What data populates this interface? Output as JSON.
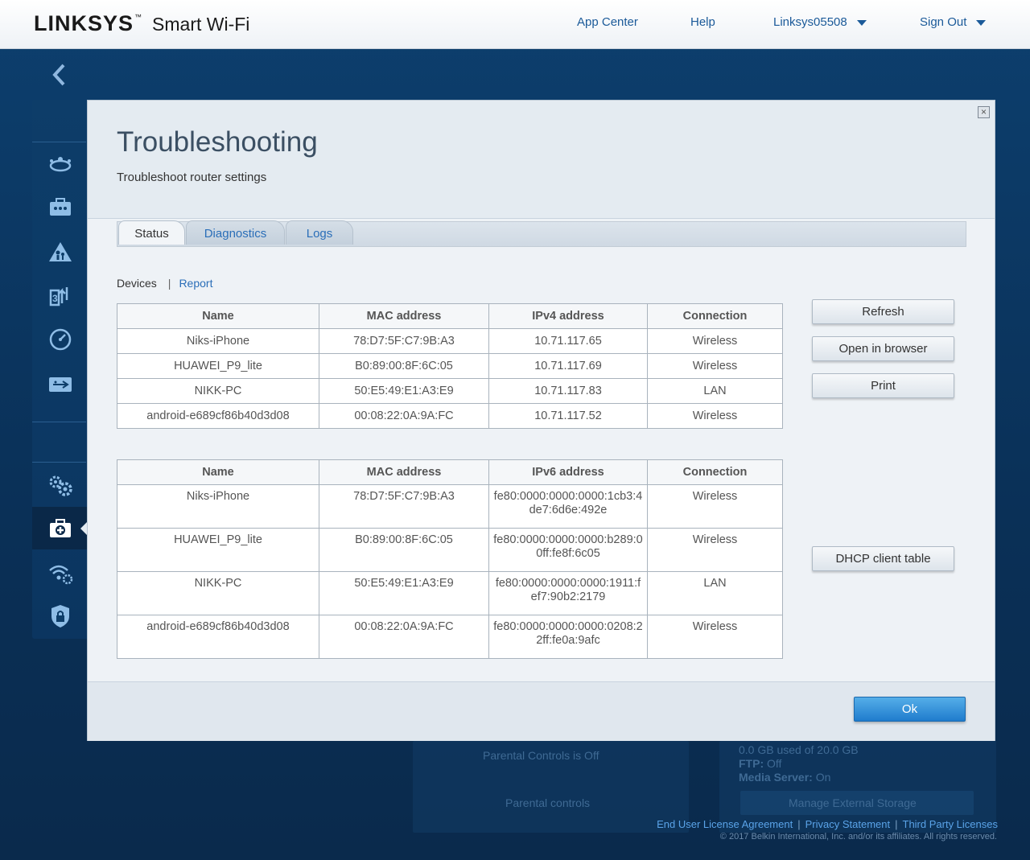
{
  "header": {
    "brand": "LINKSYS",
    "brand_tm": "™",
    "brand_sub": "Smart Wi-Fi",
    "nav": {
      "app_center": "App Center",
      "help": "Help",
      "account": "Linksys05508",
      "sign_out": "Sign Out"
    }
  },
  "sidebar": {
    "icons": [
      "network-map-icon",
      "devices-icon",
      "parental-controls-icon",
      "media-prioritization-icon",
      "speed-test-icon",
      "usb-storage-icon",
      "connectivity-icon",
      "troubleshooting-icon",
      "wireless-icon",
      "security-icon"
    ],
    "active": "troubleshooting-icon"
  },
  "background": {
    "text_1": "Parental Controls is Off",
    "text_2": "Parental controls",
    "text_3": "0.0 GB used of 20.0 GB",
    "ftp_label": "FTP:",
    "ftp_value": "Off",
    "media_label": "Media Server:",
    "media_value": "On",
    "manage_button": "Manage External Storage"
  },
  "modal": {
    "title": "Troubleshooting",
    "subtitle": "Troubleshoot router settings",
    "close_glyph": "×",
    "tabs": [
      "Status",
      "Diagnostics",
      "Logs"
    ],
    "active_tab": "Status",
    "subnav": {
      "devices": "Devices",
      "report": "Report"
    },
    "ipv4_table": {
      "headers": [
        "Name",
        "MAC address",
        "IPv4 address",
        "Connection"
      ],
      "rows": [
        [
          "Niks-iPhone",
          "78:D7:5F:C7:9B:A3",
          "10.71.117.65",
          "Wireless"
        ],
        [
          "HUAWEI_P9_lite",
          "B0:89:00:8F:6C:05",
          "10.71.117.69",
          "Wireless"
        ],
        [
          "NIKK-PC",
          "50:E5:49:E1:A3:E9",
          "10.71.117.83",
          "LAN"
        ],
        [
          "android-e689cf86b40d3d08",
          "00:08:22:0A:9A:FC",
          "10.71.117.52",
          "Wireless"
        ]
      ]
    },
    "ipv6_table": {
      "headers": [
        "Name",
        "MAC address",
        "IPv6 address",
        "Connection"
      ],
      "rows": [
        [
          "Niks-iPhone",
          "78:D7:5F:C7:9B:A3",
          "fe80:0000:0000:0000:1cb3:4",
          "de7:6d6e:492e",
          "Wireless"
        ],
        [
          "HUAWEI_P9_lite",
          "B0:89:00:8F:6C:05",
          "fe80:0000:0000:0000:b289:0",
          "0ff:fe8f:6c05",
          "Wireless"
        ],
        [
          "NIKK-PC",
          "50:E5:49:E1:A3:E9",
          "fe80:0000:0000:0000:1911:f",
          "ef7:90b2:2179",
          "LAN"
        ],
        [
          "android-e689cf86b40d3d08",
          "00:08:22:0A:9A:FC",
          "fe80:0000:0000:0000:0208:2",
          "2ff:fe0a:9afc",
          "Wireless"
        ]
      ]
    },
    "buttons": {
      "refresh": "Refresh",
      "open_in_browser": "Open in browser",
      "print": "Print",
      "dhcp": "DHCP client table",
      "ok": "Ok"
    }
  },
  "footer": {
    "eula": "End User License Agreement",
    "privacy": "Privacy Statement",
    "third_party": "Third Party Licenses",
    "copyright": "© 2017 Belkin International, Inc. and/or its affiliates. All rights reserved."
  }
}
